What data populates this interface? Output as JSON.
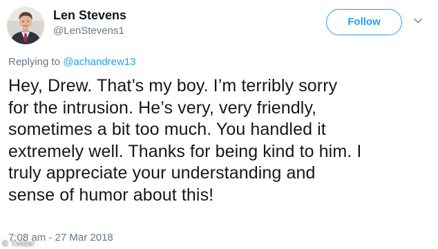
{
  "tweet": {
    "author": {
      "display_name": "Len Stevens",
      "handle": "@LenStevens1",
      "avatar": "profile-photo"
    },
    "follow_label": "Follow",
    "menu_icon": "chevron-down-icon",
    "reply_prefix": "Replying to",
    "reply_to": "@achandrew13",
    "text_lines": [
      "Hey, Drew. That’s my boy. I’m terribly sorry",
      "for the intrusion. He’s very, very friendly,",
      "sometimes a bit too much. You handled it",
      "extremely well. Thanks for being kind to him. I",
      "truly appreciate your understanding and",
      "sense of humor about this!"
    ],
    "timestamp": "7:08 am - 27 Mar 2018"
  },
  "watermark": "© Twitter",
  "colors": {
    "accent": "#1da1f2",
    "secondary_text": "#657786",
    "primary_text": "#14171a"
  }
}
